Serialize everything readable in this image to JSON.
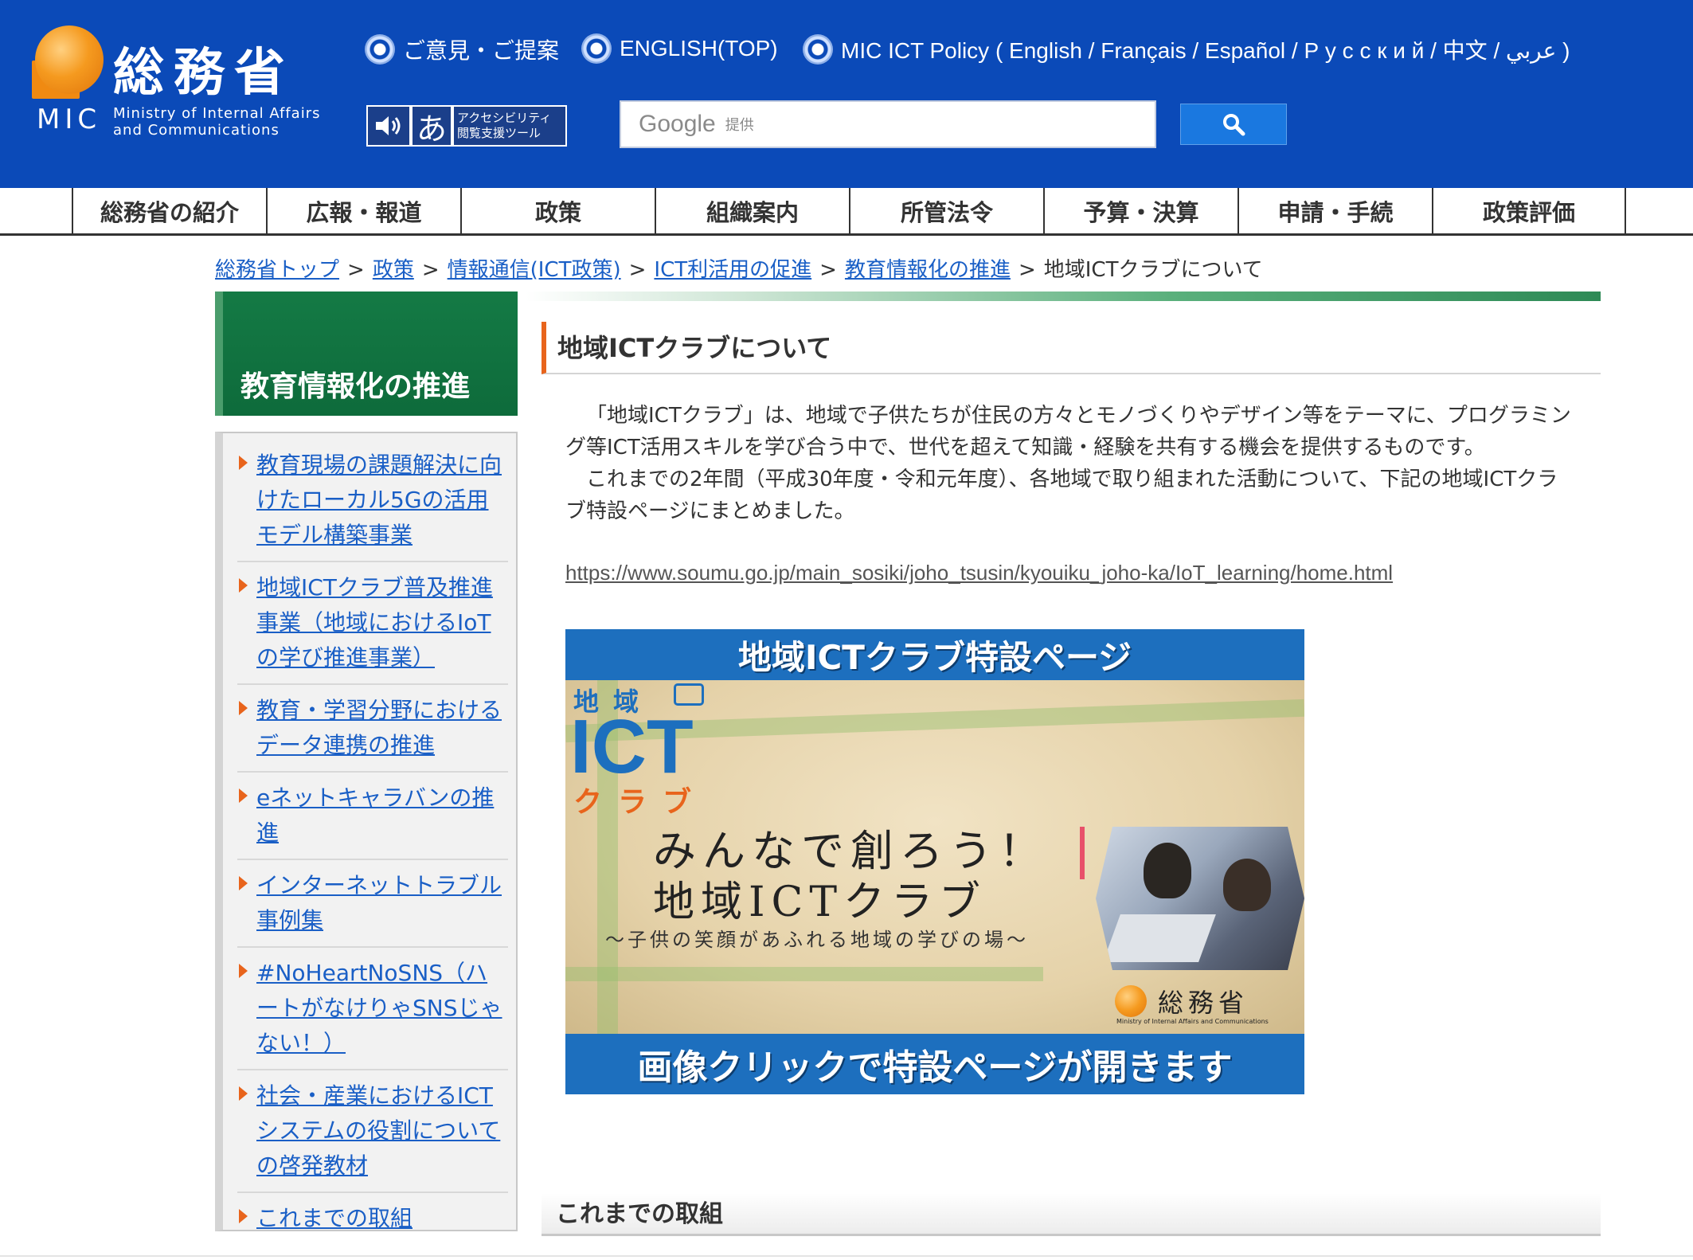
{
  "header": {
    "logo": {
      "kanji": "総務省",
      "abbr": "MIC",
      "english_line1": "Ministry of Internal Affairs",
      "english_line2": "and Communications"
    },
    "links": {
      "opinion": "ご意見・ご提案",
      "english_top": "ENGLISH(TOP)",
      "ict_policy": "MIC ICT Policy ( English / Français / Español / Р у с с к и й / 中文 / عربي )"
    },
    "accessibility": {
      "speaker_icon": "speaker-icon",
      "a_glyph": "あ",
      "line1": "アクセシビリティ",
      "line2": "閲覧支援ツール"
    },
    "search": {
      "brand": "Google",
      "sub": "提供",
      "button_icon": "magnifier-icon"
    },
    "colors": {
      "background": "#0b4ab8",
      "search_button": "#1a78e0"
    }
  },
  "global_nav": [
    "総務省の紹介",
    "広報・報道",
    "政策",
    "組織案内",
    "所管法令",
    "予算・決算",
    "申請・手続",
    "政策評価"
  ],
  "breadcrumb": {
    "items": [
      "総務省トップ",
      "政策",
      "情報通信(ICT政策)",
      "ICT利活用の促進",
      "教育情報化の推進"
    ],
    "current": "地域ICTクラブについて",
    "separator": ">"
  },
  "sidebar": {
    "title": "教育情報化の推進",
    "items": [
      "教育現場の課題解決に向けたローカル5Gの活用モデル構築事業",
      "地域ICTクラブ普及推進事業（地域におけるIoTの学び推進事業）",
      "教育・学習分野におけるデータ連携の推進",
      "eネットキャラバンの推進",
      "インターネットトラブル事例集",
      "#NoHeartNoSNS（ハートがなけりゃSNSじゃない！）",
      "社会・産業におけるICTシステムの役割についての啓発教材",
      "これまでの取組"
    ],
    "colors": {
      "title_bg": "#0e6b3b",
      "marker": "#e8641c"
    }
  },
  "main": {
    "title": "地域ICTクラブについて",
    "paragraph1": "「地域ICTクラブ」は、地域で子供たちが住民の方々とモノづくりやデザイン等をテーマに、プログラミング等ICT活用スキルを学び合う中で、世代を超えて知識・経験を共有する機会を提供するものです。",
    "paragraph2": "これまでの2年間（平成30年度・令和元年度）、各地域で取り組まれた活動について、下記の地域ICTクラブ特設ページにまとめました。",
    "link": "https://www.soumu.go.jp/main_sosiki/joho_tsusin/kyouiku_joho-ka/IoT_learning/home.html",
    "banner": {
      "top": "地域ICTクラブ特設ページ",
      "logo_chiiki": "地域",
      "logo_ict": "ICT",
      "logo_club": "クラブ",
      "line1": "みんなで創ろう！",
      "line2": "地域ICTクラブ",
      "subtitle": "～子供の笑顔があふれる地域の学びの場～",
      "mic_name": "総務省",
      "mic_en": "Ministry of Internal Affairs and Communications",
      "bottom": "画像クリックで特設ページが開きます"
    },
    "section2_title": "これまでの取組"
  }
}
